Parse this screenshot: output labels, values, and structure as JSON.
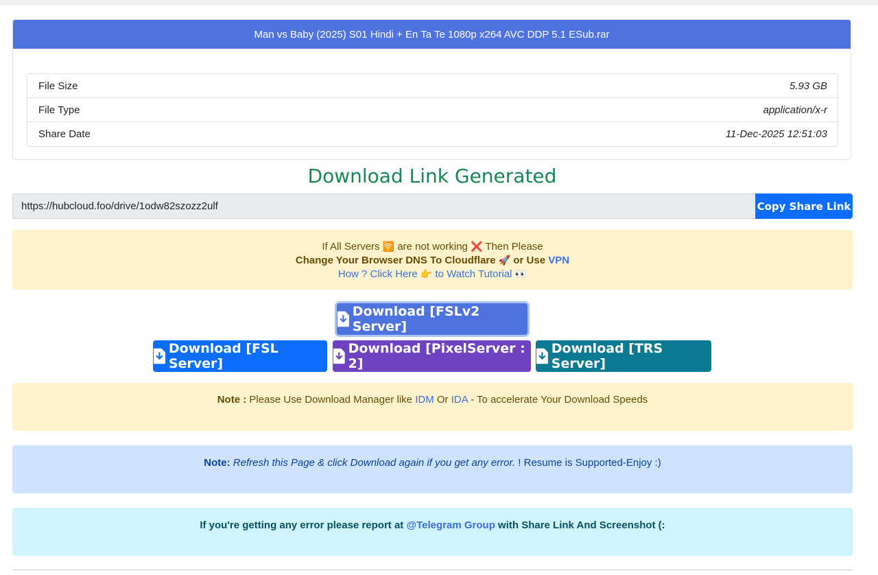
{
  "file": {
    "name": "Man vs Baby (2025) S01 Hindi + En Ta Te 1080p x264 AVC DDP 5.1 ESub.rar",
    "rows": [
      {
        "label": "File Size",
        "value": "5.93 GB"
      },
      {
        "label": "File Type",
        "value": "application/x-r"
      },
      {
        "label": "Share Date",
        "value": "11-Dec-2025 12:51:03"
      }
    ]
  },
  "generated_title": "Download Link Generated",
  "share": {
    "url": "https://hubcloud.foo/drive/1odw82szozz2ulf",
    "copy_label": "Copy Share Link"
  },
  "dns_alert": {
    "line1_a": "If All Servers",
    "line1_wifi": "🛜",
    "line1_b": "are not working",
    "line1_x": "❌",
    "line1_c": "Then Please",
    "line2_a": "Change Your Browser DNS To Cloudflare",
    "line2_rocket": "🚀",
    "line2_b": "or Use",
    "line2_vpn": "VPN",
    "line3_a": "How ? Click Here",
    "line3_hand": "👉",
    "line3_b": "to Watch Tutorial",
    "line3_eyes": "👀"
  },
  "buttons": {
    "fslv2": "Download [FSLv2 Server]",
    "fsl": "Download [FSL Server]",
    "pixel": "Download [PixelServer : 2]",
    "trs": "Download [TRS Server]"
  },
  "note1": {
    "bold": "Note :",
    "text_a": "Please Use Download Manager like",
    "idm": "IDM",
    "or": "Or",
    "ida": "IDA",
    "text_b": "- To accelerate Your Download Speeds"
  },
  "note2": {
    "bold": "Note:",
    "italic": "Refresh this Page & click Download again if you get any error.",
    "rest": "! Resume is Supported-Enjoy :)"
  },
  "report": {
    "text_a": "If you're getting any error please report at",
    "link": "@Telegram Group",
    "text_b": "with Share Link And Screenshot (:"
  },
  "colors": {
    "header": "#4e73df",
    "success": "#198754",
    "primary": "#0d6efd",
    "purple": "#6f42c1",
    "teal": "#0d7a94"
  }
}
